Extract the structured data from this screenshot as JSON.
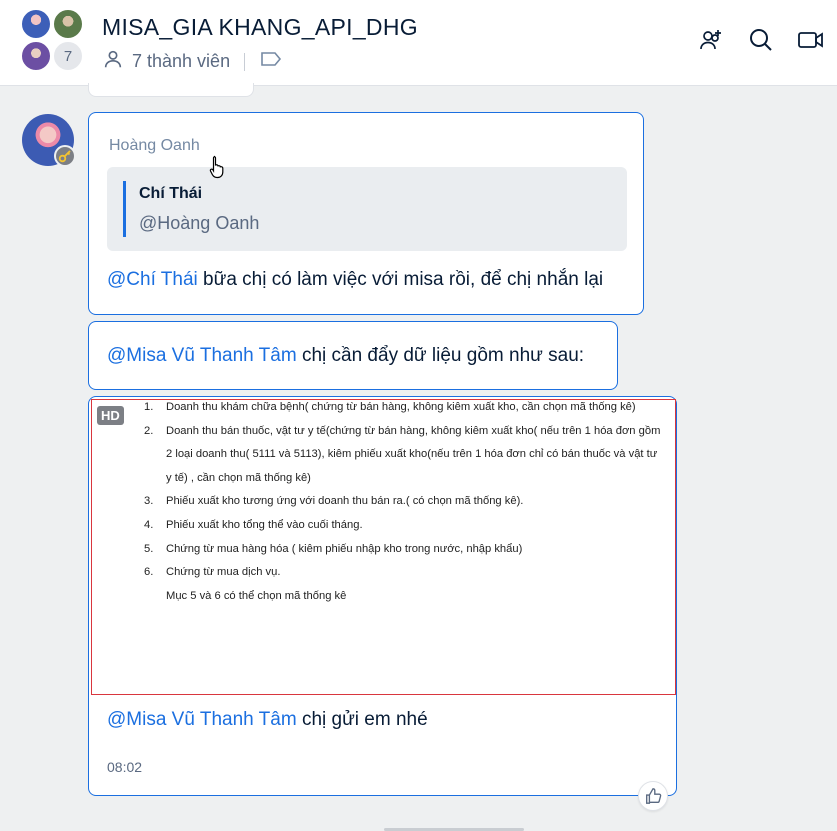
{
  "header": {
    "title": "MISA_GIA KHANG_API_DHG",
    "member_count_badge": "7",
    "members_label": "7 thành viên",
    "icons": [
      "add-member-icon",
      "search-icon",
      "video-call-icon",
      "tag-icon",
      "members-icon"
    ]
  },
  "messages": [
    {
      "sender": "Hoàng Oanh",
      "quote": {
        "name": "Chí Thái",
        "text": "@Hoàng Oanh"
      },
      "mention": "@Chí Thái",
      "text": " bữa chị có làm việc với misa rồi, để chị nhắn lại"
    },
    {
      "mention": "@Misa Vũ Thanh Tâm",
      "text": " chị cần đẩy dữ liệu gồm như sau:"
    },
    {
      "image": {
        "hd_badge": "HD",
        "items": [
          {
            "num": "1.",
            "text": "Doanh thu khám chữa bệnh( chứng từ bán hàng, không kiêm xuất kho, cần chọn mã thống kê)"
          },
          {
            "num": "2.",
            "text": "Doanh thu bán thuốc, vật tư y tế(chứng từ bán hàng, không kiêm xuất kho( nếu trên 1 hóa đơn gồm 2 loại doanh thu( 5111 và 5113), kiêm phiếu xuất kho(nếu trên 1 hóa đơn chỉ có bán thuốc và vật tư y tế) , cần chọn mã thống kê)"
          },
          {
            "num": "3.",
            "text": "Phiếu xuất kho tương ứng với doanh thu bán ra.( có chọn mã thống kê)."
          },
          {
            "num": "4.",
            "text": "Phiếu xuất kho tổng thể vào cuối tháng."
          },
          {
            "num": "5.",
            "text": "Chứng từ mua hàng hóa ( kiêm phiếu nhập kho trong nước, nhập khẩu)"
          },
          {
            "num": "6.",
            "text": "Chứng từ mua dịch vụ."
          }
        ],
        "note": "Mục 5 và 6 có thể chọn mã thống kê"
      },
      "mention": "@Misa Vũ Thanh Tâm",
      "text": " chị gửi em nhé",
      "time": "08:02"
    }
  ],
  "colors": {
    "accent": "#1b6fe0",
    "bubble_border": "#1b6fe0",
    "background": "#eef0f1",
    "image_border": "#d9363e"
  }
}
